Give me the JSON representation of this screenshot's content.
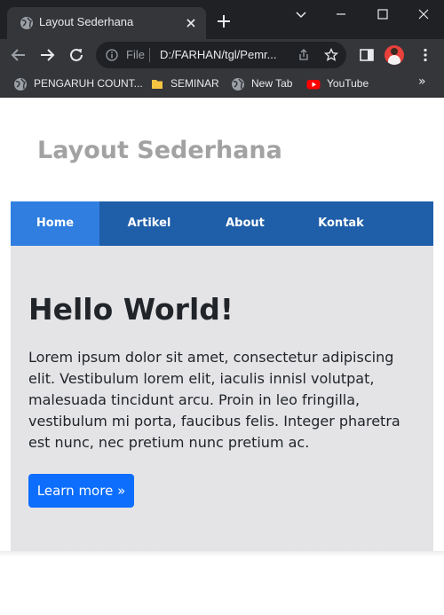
{
  "browser": {
    "tab": {
      "title": "Layout Sederhana",
      "icon": "globe-icon"
    },
    "address_bar": {
      "scheme_label": "File",
      "url": "D:/FARHAN/tgl/Pemr..."
    },
    "bookmarks": [
      {
        "label": "PENGARUH COUNT...",
        "icon": "globe-icon"
      },
      {
        "label": "SEMINAR",
        "icon": "folder-icon"
      },
      {
        "label": "New Tab",
        "icon": "globe-icon"
      },
      {
        "label": "YouTube",
        "icon": "youtube-icon"
      }
    ],
    "bookmarks_overflow": "»",
    "colors": {
      "chrome_dark": "#202124",
      "chrome_surface": "#35363a",
      "chrome_text": "#e8eaed"
    }
  },
  "page": {
    "title": "Layout Sederhana",
    "nav": [
      {
        "label": "Home",
        "active": true
      },
      {
        "label": "Artikel",
        "active": false
      },
      {
        "label": "About",
        "active": false
      },
      {
        "label": "Kontak",
        "active": false
      }
    ],
    "hero": {
      "heading": "Hello World!",
      "text": "Lorem ipsum dolor sit amet, consectetur adipiscing elit. Vestibulum lorem elit, iaculis innisl volutpat, malesuada tincidunt arcu. Proin in leo fringilla, vestibulum mi porta, faucibus felis. Integer pharetra est nunc, nec pretium nunc pretium ac.",
      "button_label": "Learn more »"
    },
    "colors": {
      "nav_bg": "#1f5ea8",
      "nav_active": "#2f7ee0",
      "hero_bg": "#e4e4e7",
      "button_bg": "#0d6efd",
      "title_color": "#a2a2a2"
    }
  }
}
